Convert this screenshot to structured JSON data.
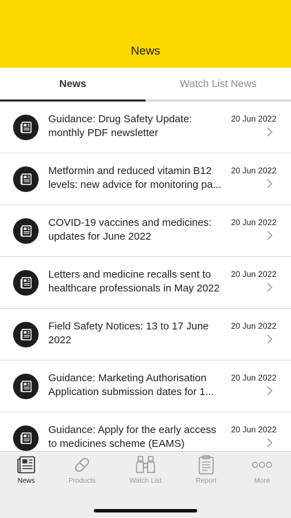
{
  "header": {
    "title": "News"
  },
  "tabs": [
    {
      "label": "News"
    },
    {
      "label": "Watch List News"
    }
  ],
  "news": [
    {
      "title": "Guidance: Drug Safety Update: monthly PDF newsletter",
      "date": "20 Jun 2022",
      "icon": "newspaper-icon"
    },
    {
      "title": "Metformin and reduced vitamin B12 levels: new advice for monitoring pa...",
      "date": "20 Jun 2022",
      "icon": "newspaper-icon"
    },
    {
      "title": "COVID-19 vaccines and medicines: updates for June 2022",
      "date": "20 Jun 2022",
      "icon": "newspaper-icon"
    },
    {
      "title": "Letters and medicine recalls sent to healthcare professionals in May 2022",
      "date": "20 Jun 2022",
      "icon": "newspaper-icon"
    },
    {
      "title": "Field Safety Notices: 13 to 17 June 2022",
      "date": "20 Jun 2022",
      "icon": "newspaper-icon"
    },
    {
      "title": "Guidance: Marketing Authorisation Application submission dates for 1...",
      "date": "20 Jun 2022",
      "icon": "newspaper-icon"
    },
    {
      "title": "Guidance: Apply for the early access to medicines scheme (EAMS)",
      "date": "20 Jun 2022",
      "icon": "newspaper-icon"
    }
  ],
  "bottom_nav": [
    {
      "label": "News",
      "icon": "newspaper-icon",
      "active": true
    },
    {
      "label": "Products",
      "icon": "pill-icon",
      "active": false
    },
    {
      "label": "Watch List",
      "icon": "binoculars-icon",
      "active": false
    },
    {
      "label": "Report",
      "icon": "clipboard-icon",
      "active": false
    },
    {
      "label": "More",
      "icon": "more-dots-icon",
      "active": false
    }
  ],
  "colors": {
    "header_bg": "#fdd800",
    "icon_bg": "#1d1d1d",
    "tab_indicator": "#2b2b2b",
    "nav_inactive": "#9a9a9a"
  }
}
